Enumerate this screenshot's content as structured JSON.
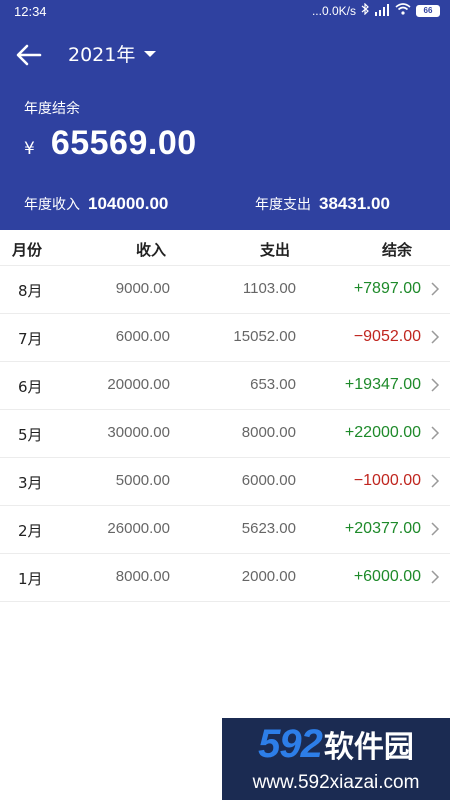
{
  "status_bar": {
    "time": "12:34",
    "network_speed": "...0.0K/s",
    "battery": "66"
  },
  "toolbar": {
    "year": "2021年"
  },
  "summary": {
    "balance_label": "年度结余",
    "currency": "¥",
    "balance_value": "65569.00",
    "income_label": "年度收入",
    "income_value": "104000.00",
    "expense_label": "年度支出",
    "expense_value": "38431.00"
  },
  "table": {
    "headers": {
      "month": "月份",
      "income": "收入",
      "expense": "支出",
      "balance": "结余"
    },
    "rows": [
      {
        "month": "8月",
        "income": "9000.00",
        "expense": "1103.00",
        "balance": "+7897.00",
        "positive": true
      },
      {
        "month": "7月",
        "income": "6000.00",
        "expense": "15052.00",
        "balance": "−9052.00",
        "positive": false
      },
      {
        "month": "6月",
        "income": "20000.00",
        "expense": "653.00",
        "balance": "+19347.00",
        "positive": true
      },
      {
        "month": "5月",
        "income": "30000.00",
        "expense": "8000.00",
        "balance": "+22000.00",
        "positive": true
      },
      {
        "month": "3月",
        "income": "5000.00",
        "expense": "6000.00",
        "balance": "−1000.00",
        "positive": false
      },
      {
        "month": "2月",
        "income": "26000.00",
        "expense": "5623.00",
        "balance": "+20377.00",
        "positive": true
      },
      {
        "month": "1月",
        "income": "8000.00",
        "expense": "2000.00",
        "balance": "+6000.00",
        "positive": true
      }
    ]
  },
  "colors": {
    "header_bg": "#2f41a0",
    "positive": "#1e8a2a",
    "negative": "#c0261f"
  },
  "watermark": {
    "number": "592",
    "text": "软件园",
    "url": "www.592xiazai.com"
  }
}
